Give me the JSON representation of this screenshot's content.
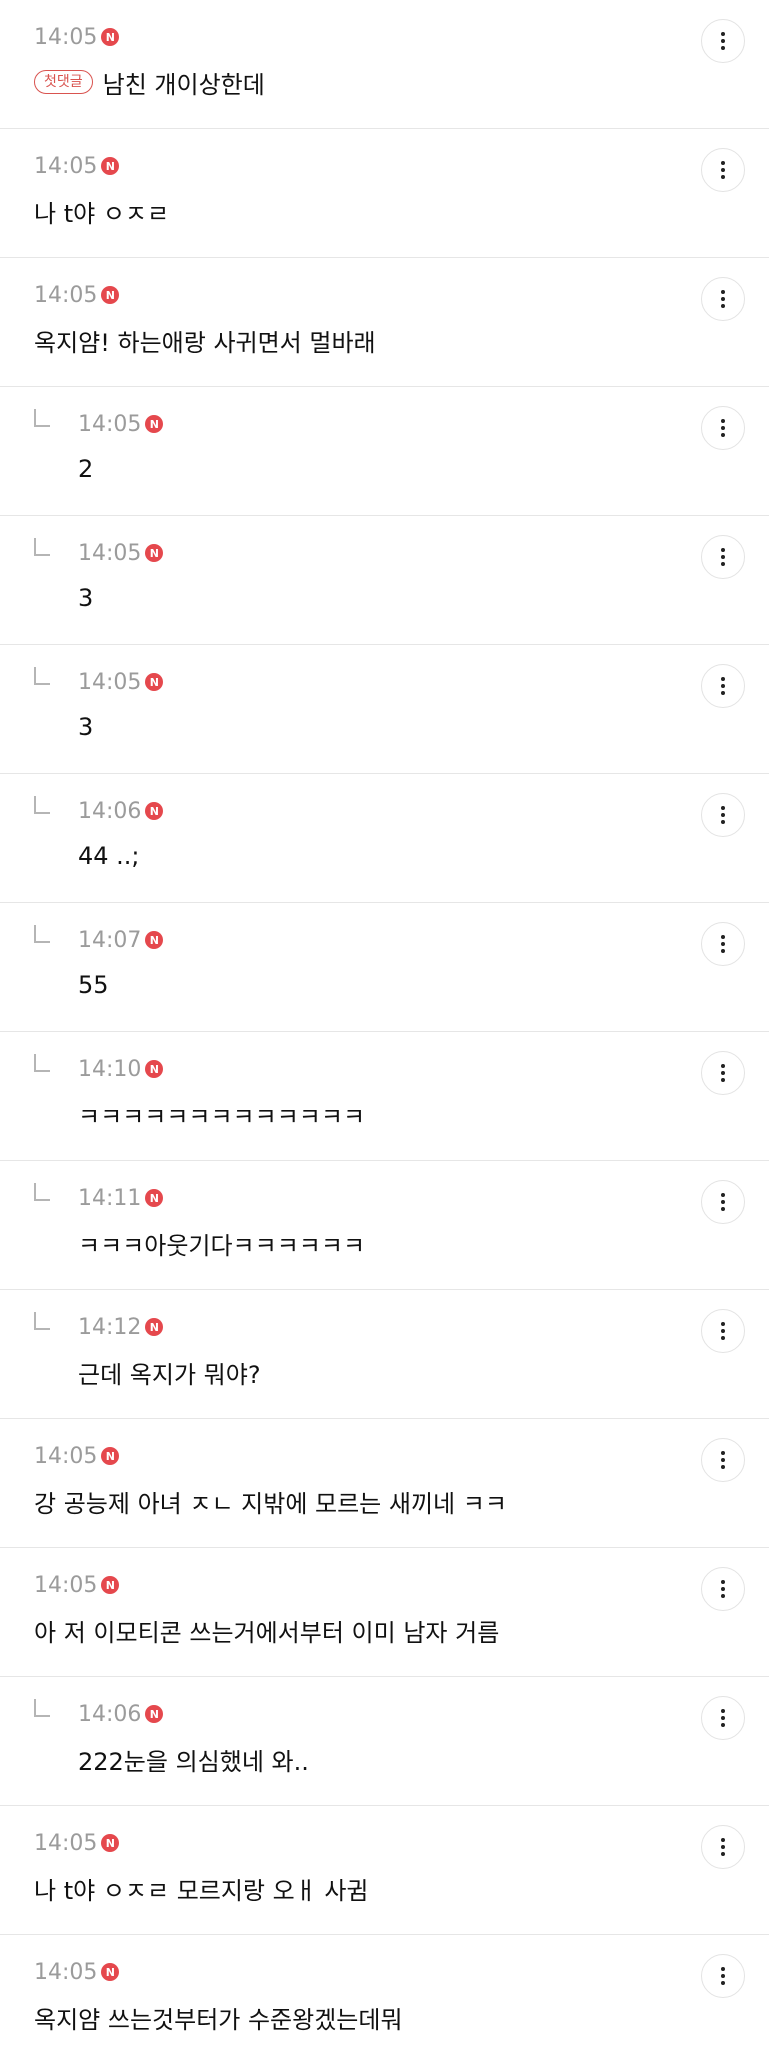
{
  "badge_label": "N",
  "first_comment_tag": "첫댓글",
  "comments": [
    {
      "time": "14:05",
      "text": "남친 개이상한데",
      "reply": false,
      "first": true
    },
    {
      "time": "14:05",
      "text": "나 t야 ㅇㅈㄹ",
      "reply": false
    },
    {
      "time": "14:05",
      "text": "옥지얌! 하는애랑 사귀면서 멀바래",
      "reply": false
    },
    {
      "time": "14:05",
      "text": "2",
      "reply": true
    },
    {
      "time": "14:05",
      "text": "3",
      "reply": true
    },
    {
      "time": "14:05",
      "text": "3",
      "reply": true
    },
    {
      "time": "14:06",
      "text": "44 ..;",
      "reply": true
    },
    {
      "time": "14:07",
      "text": "55",
      "reply": true
    },
    {
      "time": "14:10",
      "text": "ㅋㅋㅋㅋㅋㅋㅋㅋㅋㅋㅋㅋㅋ",
      "reply": true
    },
    {
      "time": "14:11",
      "text": "ㅋㅋㅋ아웃기다ㅋㅋㅋㅋㅋㅋ",
      "reply": true
    },
    {
      "time": "14:12",
      "text": "근데 옥지가 뭐야?",
      "reply": true
    },
    {
      "time": "14:05",
      "text": "강 공능제 아녀 ㅈㄴ 지밖에 모르는 새끼네 ㅋㅋ",
      "reply": false
    },
    {
      "time": "14:05",
      "text": "아 저 이모티콘 쓰는거에서부터 이미 남자 거름",
      "reply": false
    },
    {
      "time": "14:06",
      "text": "222눈을 의심했네 와..",
      "reply": true
    },
    {
      "time": "14:05",
      "text": "나 t야 ㅇㅈㄹ 모르지랑 오ㅐ 사귐",
      "reply": false
    },
    {
      "time": "14:05",
      "text": "옥지얌 쓰는것부터가 수준왕겠는데뭐",
      "reply": false
    }
  ]
}
